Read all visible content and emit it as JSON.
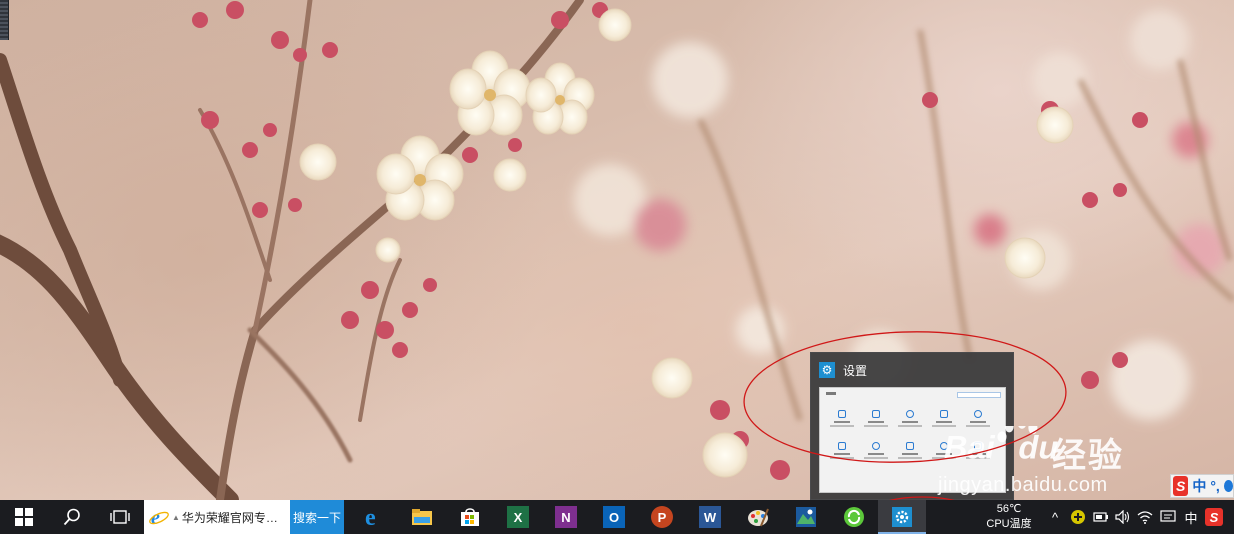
{
  "thumbnail": {
    "title": "设置",
    "app_icon": "gear-icon",
    "preview_label": "设置",
    "preview_items": 10
  },
  "watermark": {
    "brand": "Bai du",
    "product": "经验",
    "url": "jingyan.baidu.com"
  },
  "ime": {
    "logo": "S",
    "mode": "中",
    "punct": "°,"
  },
  "taskbar": {
    "start_icon": "windows-logo-icon",
    "search_icon": "search-icon",
    "taskview_icon": "task-view-icon",
    "ie_address": "华为荣耀官网专…",
    "ie_search_button": "搜索一下",
    "apps": [
      {
        "name": "edge",
        "icon": "edge-icon",
        "running": false
      },
      {
        "name": "file-explorer",
        "icon": "folder-icon",
        "running": false
      },
      {
        "name": "store",
        "icon": "store-icon",
        "running": false
      },
      {
        "name": "excel",
        "icon": "excel-icon",
        "letter": "X",
        "color": "#1e7145",
        "running": false
      },
      {
        "name": "onenote",
        "icon": "onenote-icon",
        "letter": "N",
        "color": "#7e2f8f",
        "running": false
      },
      {
        "name": "outlook",
        "icon": "outlook-icon",
        "letter": "O",
        "color": "#0a64b8",
        "running": false
      },
      {
        "name": "powerpoint",
        "icon": "powerpoint-icon",
        "letter": "P",
        "color": "#c5451f",
        "running": false
      },
      {
        "name": "word",
        "icon": "word-icon",
        "letter": "W",
        "color": "#2b5797",
        "running": false
      },
      {
        "name": "paint",
        "icon": "paint-palette-icon",
        "running": false
      },
      {
        "name": "photo-app",
        "icon": "photo-app-icon",
        "running": false
      },
      {
        "name": "green-app",
        "icon": "green-circle-icon",
        "running": false
      },
      {
        "name": "settings",
        "icon": "gear-icon",
        "running": true,
        "active": true
      }
    ],
    "cpu_temp": "56℃",
    "cpu_label": "CPU温度",
    "tray": {
      "show_hidden": "^",
      "ime_mode": "中",
      "ime_logo": "S"
    }
  }
}
